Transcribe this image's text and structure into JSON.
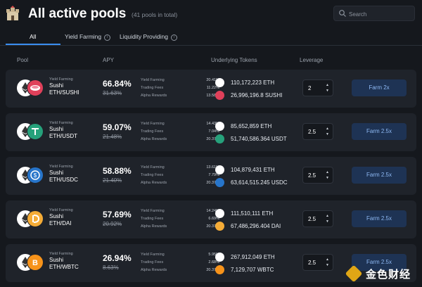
{
  "header": {
    "title": "All active pools",
    "count": "(41 pools in total)"
  },
  "search": {
    "placeholder": "Search"
  },
  "tabs": [
    {
      "label": "All"
    },
    {
      "label": "Yield Farming"
    },
    {
      "label": "Liquidity Providing"
    }
  ],
  "columns": {
    "pool": "Pool",
    "apy": "APY",
    "tokens": "Underlying Tokens",
    "leverage": "Leverage"
  },
  "breakdown_labels": {
    "yf": "Yield Farming",
    "tf": "Trading Fees",
    "ar": "Alpha Rewards"
  },
  "pools": [
    {
      "type": "Yield Farming",
      "dex": "Sushi",
      "pair": "ETH/SUSHI",
      "apy": "66.84%",
      "apy_old": "31.63%",
      "yf": "20.41%",
      "tf": "11.22%",
      "ar": "13.58%",
      "tok1": "110,172,223 ETH",
      "tok2": "26,996,196.8 SUSHI",
      "leverage": "2",
      "farm": "Farm 2x"
    },
    {
      "type": "Yield Farming",
      "dex": "Sushi",
      "pair": "ETH/USDT",
      "apy": "59.07%",
      "apy_old": "21.48%",
      "yf": "14.43%",
      "tf": "7.04%",
      "ar": "20.37%",
      "tok1": "85,652,859 ETH",
      "tok2": "51,740,586.364 USDT",
      "leverage": "2.5",
      "farm": "Farm 2.5x"
    },
    {
      "type": "Yield Farming",
      "dex": "Sushi",
      "pair": "ETH/USDC",
      "apy": "58.88%",
      "apy_old": "21.40%",
      "yf": "13.61%",
      "tf": "7.79%",
      "ar": "20.37%",
      "tok1": "104,879,431 ETH",
      "tok2": "63,614,515.245 USDC",
      "leverage": "2.5",
      "farm": "Farm 2.5x"
    },
    {
      "type": "Yield Farming",
      "dex": "Sushi",
      "pair": "ETH/DAI",
      "apy": "57.69%",
      "apy_old": "20.92%",
      "yf": "14.24%",
      "tf": "6.69%",
      "ar": "20.37%",
      "tok1": "111,510,111 ETH",
      "tok2": "67,486,296.404 DAI",
      "leverage": "2.5",
      "farm": "Farm 2.5x"
    },
    {
      "type": "Yield Farming",
      "dex": "Sushi",
      "pair": "ETH/WBTC",
      "apy": "26.94%",
      "apy_old": "8.63%",
      "yf": "5.95%",
      "tf": "2.68%",
      "ar": "20.37%",
      "tok1": "267,912,049 ETH",
      "tok2": "7,129,707 WBTC",
      "leverage": "2.5",
      "farm": "Farm 2.5x"
    }
  ],
  "watermark": {
    "text": "金色财经"
  },
  "colors": {
    "accent": "#3a8df0",
    "card": "#1f232a",
    "bg": "#15181d",
    "farm_button": "#1e3354",
    "eth": "#ffffff",
    "sushi": "#e0405a",
    "usdt": "#26a17b",
    "usdc": "#2775ca",
    "dai": "#f5ac37",
    "wbtc": "#f7931a"
  }
}
